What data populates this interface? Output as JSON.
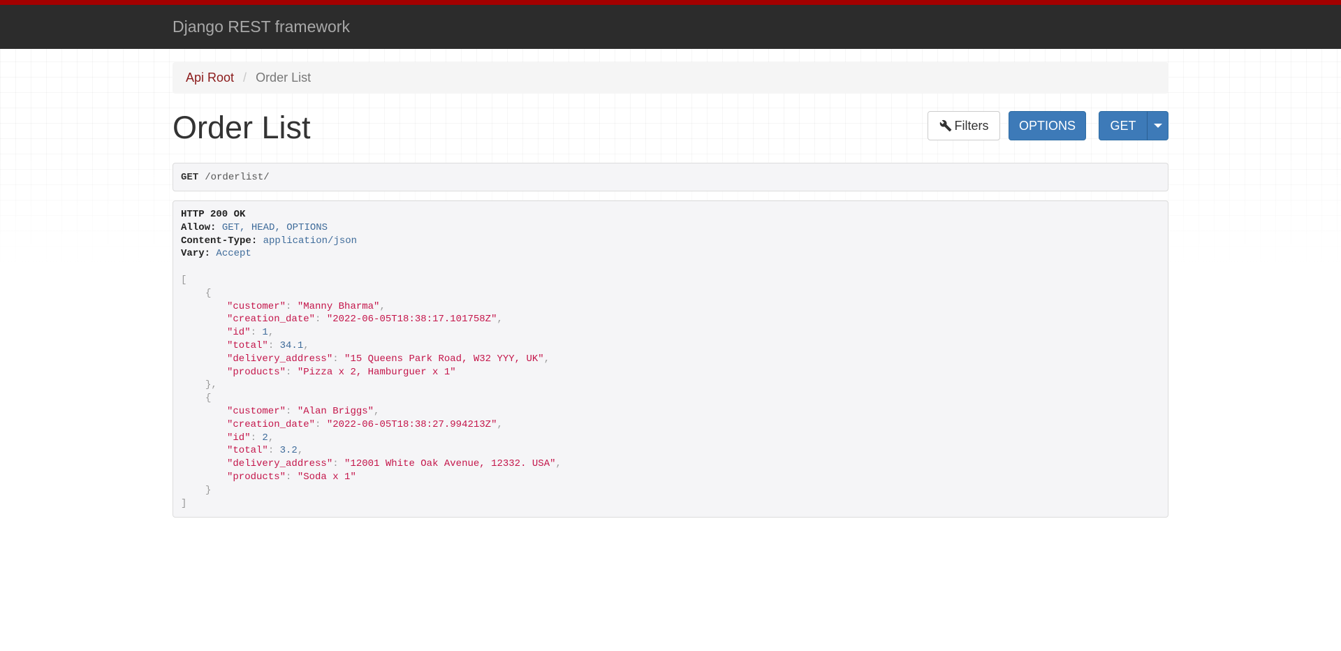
{
  "navbar": {
    "brand": "Django REST framework",
    "accent_color": "#a30000",
    "bg_color": "#2c2c2c"
  },
  "breadcrumb": {
    "items": [
      {
        "label": "Api Root",
        "link": true
      },
      {
        "label": "Order List",
        "link": false
      }
    ],
    "separator": "/"
  },
  "page": {
    "title": "Order List"
  },
  "toolbar": {
    "filters_label": "Filters",
    "filters_icon": "wrench-icon",
    "options_label": "OPTIONS",
    "get_label": "GET",
    "get_dropdown_icon": "caret-down-icon",
    "button_color": "#3d7ab8"
  },
  "request": {
    "method": "GET",
    "path": "/orderlist/"
  },
  "response": {
    "status": "HTTP 200 OK",
    "headers": [
      {
        "name": "Allow:",
        "value": "GET, HEAD, OPTIONS"
      },
      {
        "name": "Content-Type:",
        "value": "application/json"
      },
      {
        "name": "Vary:",
        "value": "Accept"
      }
    ],
    "orders": [
      {
        "customer": "\"Manny Bharma\"",
        "creation_date": "\"2022-06-05T18:38:17.101758Z\"",
        "id": "1",
        "total": "34.1",
        "delivery_address": "\"15 Queens Park Road, W32 YYY, UK\"",
        "products": "\"Pizza x 2, Hamburguer x 1\""
      },
      {
        "customer": "\"Alan Briggs\"",
        "creation_date": "\"2022-06-05T18:38:27.994213Z\"",
        "id": "2",
        "total": "3.2",
        "delivery_address": "\"12001 White Oak Avenue, 12332. USA\"",
        "products": "\"Soda x 1\""
      }
    ],
    "keys": {
      "customer": "\"customer\"",
      "creation_date": "\"creation_date\"",
      "id": "\"id\"",
      "total": "\"total\"",
      "delivery_address": "\"delivery_address\"",
      "products": "\"products\""
    }
  }
}
